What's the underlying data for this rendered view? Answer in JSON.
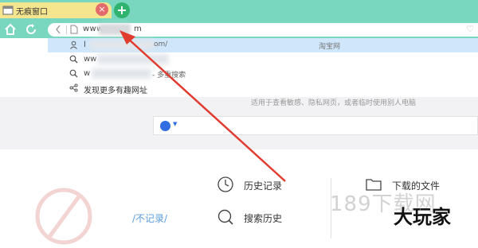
{
  "tab": {
    "title": "无痕窗口",
    "close_icon": "close-icon",
    "new_tab_label": "+"
  },
  "address": {
    "prefix": "www.",
    "suffix": "m",
    "favorite_icon": "heart-icon"
  },
  "dropdown": {
    "items": [
      {
        "icon": "user-icon",
        "text": "l",
        "extra": "淘宝网",
        "tail": "om/"
      },
      {
        "icon": "search-icon",
        "text": "ww",
        "extra": ""
      },
      {
        "icon": "search-icon",
        "text": "w",
        "extra": "- 多重搜索"
      },
      {
        "icon": "share-icon",
        "text": "发现更多有趣网址",
        "extra": ""
      }
    ]
  },
  "incognito": {
    "info": "适用于查看敏感、隐私网页，或者临时使用别人电脑",
    "no_record": "/不记录/"
  },
  "shortcuts": {
    "history": "历史记录",
    "search_history": "搜索历史",
    "downloads": "下载的文件"
  },
  "watermark": {
    "site": "189下载网",
    "brand": "大玩家"
  },
  "colors": {
    "frame": "#79d7c0",
    "tab": "#f4e58e",
    "accent": "#e03b2f",
    "highlight": "#cfe6fb"
  }
}
